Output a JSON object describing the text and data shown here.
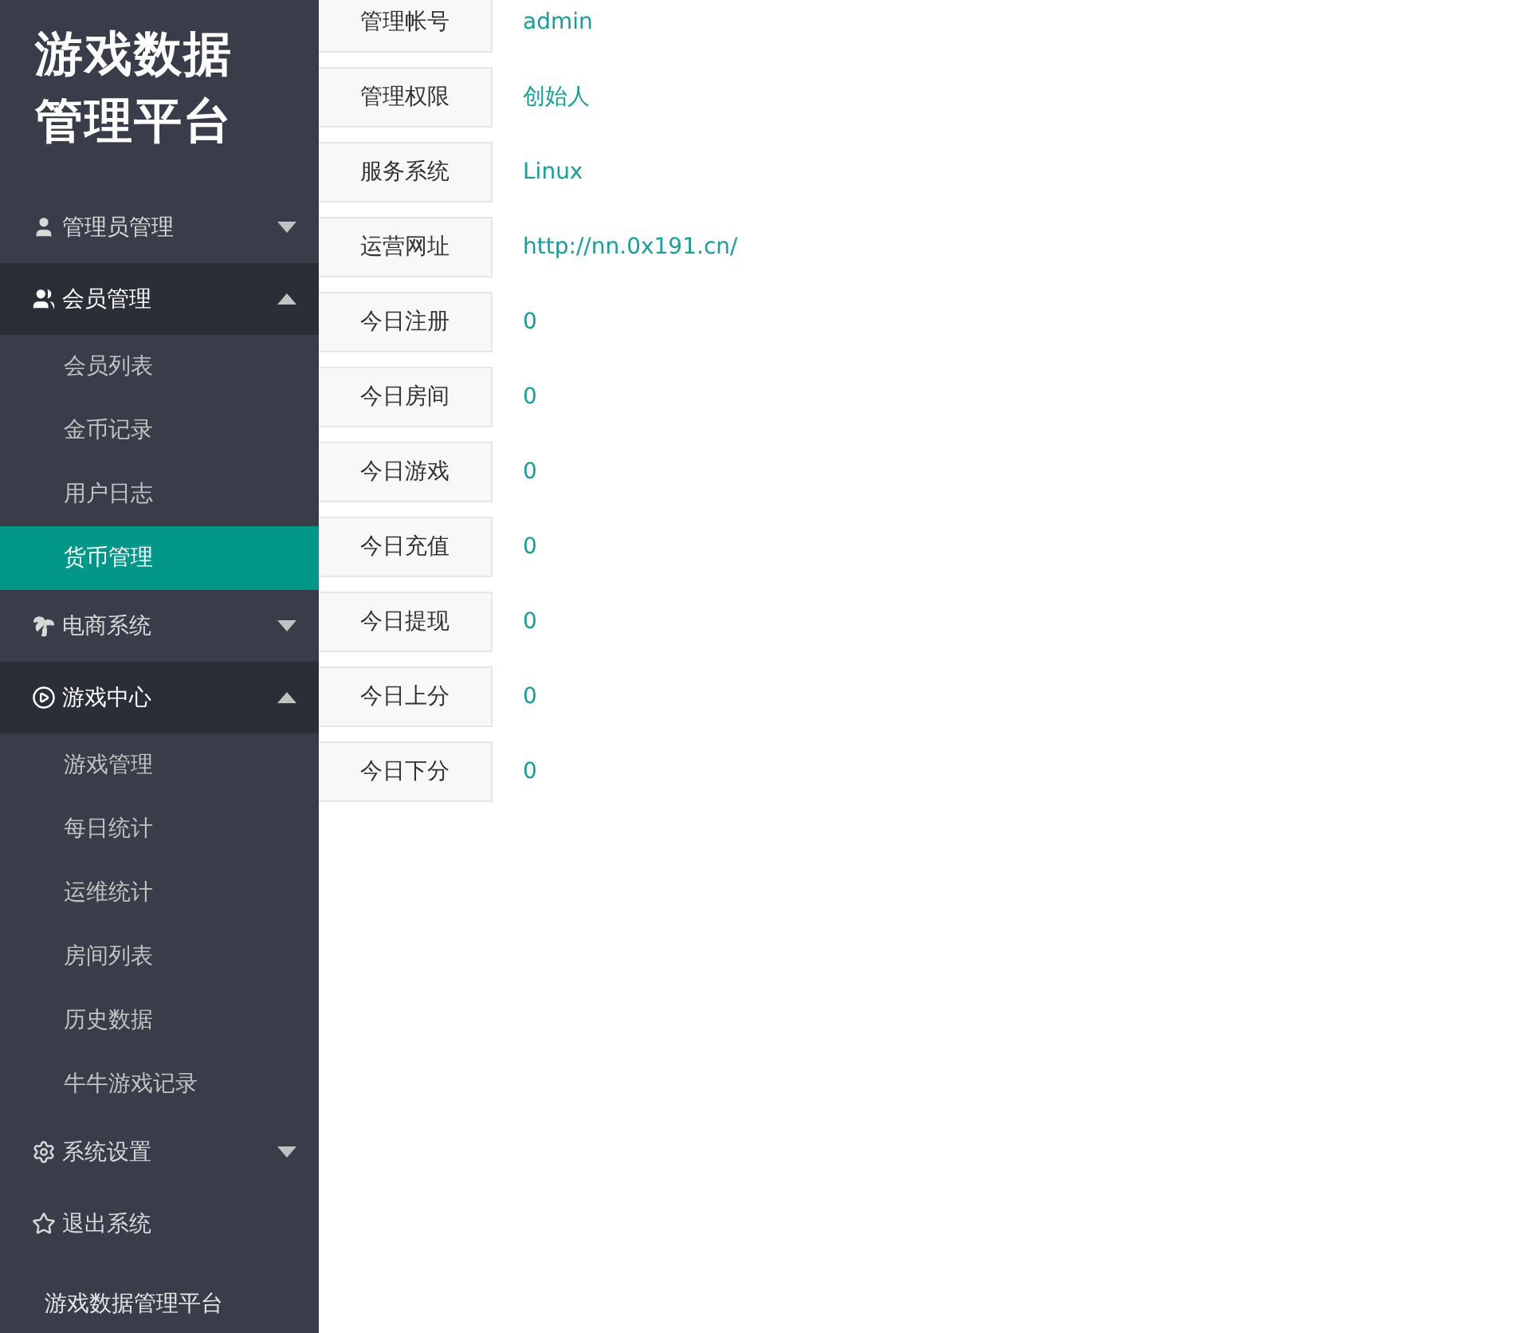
{
  "sidebar": {
    "logo": "游戏数据管理平台",
    "menu": [
      {
        "kind": "group",
        "label": "管理员管理",
        "expanded": false
      },
      {
        "kind": "group",
        "label": "会员管理",
        "expanded": true,
        "children": [
          {
            "label": "会员列表",
            "selected": false
          },
          {
            "label": "金币记录",
            "selected": false
          },
          {
            "label": "用户日志",
            "selected": false
          },
          {
            "label": "货币管理",
            "selected": true
          }
        ]
      },
      {
        "kind": "group",
        "label": "电商系统",
        "expanded": false
      },
      {
        "kind": "group",
        "label": "游戏中心",
        "expanded": true,
        "children": [
          {
            "label": "游戏管理",
            "selected": false
          },
          {
            "label": "每日统计",
            "selected": false
          },
          {
            "label": "运维统计",
            "selected": false
          },
          {
            "label": "房间列表",
            "selected": false
          },
          {
            "label": "历史数据",
            "selected": false
          },
          {
            "label": "牛牛游戏记录",
            "selected": false
          }
        ]
      },
      {
        "kind": "group",
        "label": "系统设置",
        "expanded": false
      },
      {
        "kind": "link",
        "label": "退出系统"
      }
    ],
    "footer": "游戏数据管理平台"
  },
  "info": [
    {
      "label": "管理帐号",
      "value": "admin"
    },
    {
      "label": "管理权限",
      "value": "创始人"
    },
    {
      "label": "服务系统",
      "value": "Linux"
    },
    {
      "label": "运营网址",
      "value": "http://nn.0x191.cn/"
    },
    {
      "label": "今日注册",
      "value": "0"
    },
    {
      "label": "今日房间",
      "value": "0"
    },
    {
      "label": "今日游戏",
      "value": "0"
    },
    {
      "label": "今日充值",
      "value": "0"
    },
    {
      "label": "今日提现",
      "value": "0"
    },
    {
      "label": "今日上分",
      "value": "0"
    },
    {
      "label": "今日下分",
      "value": "0"
    }
  ]
}
